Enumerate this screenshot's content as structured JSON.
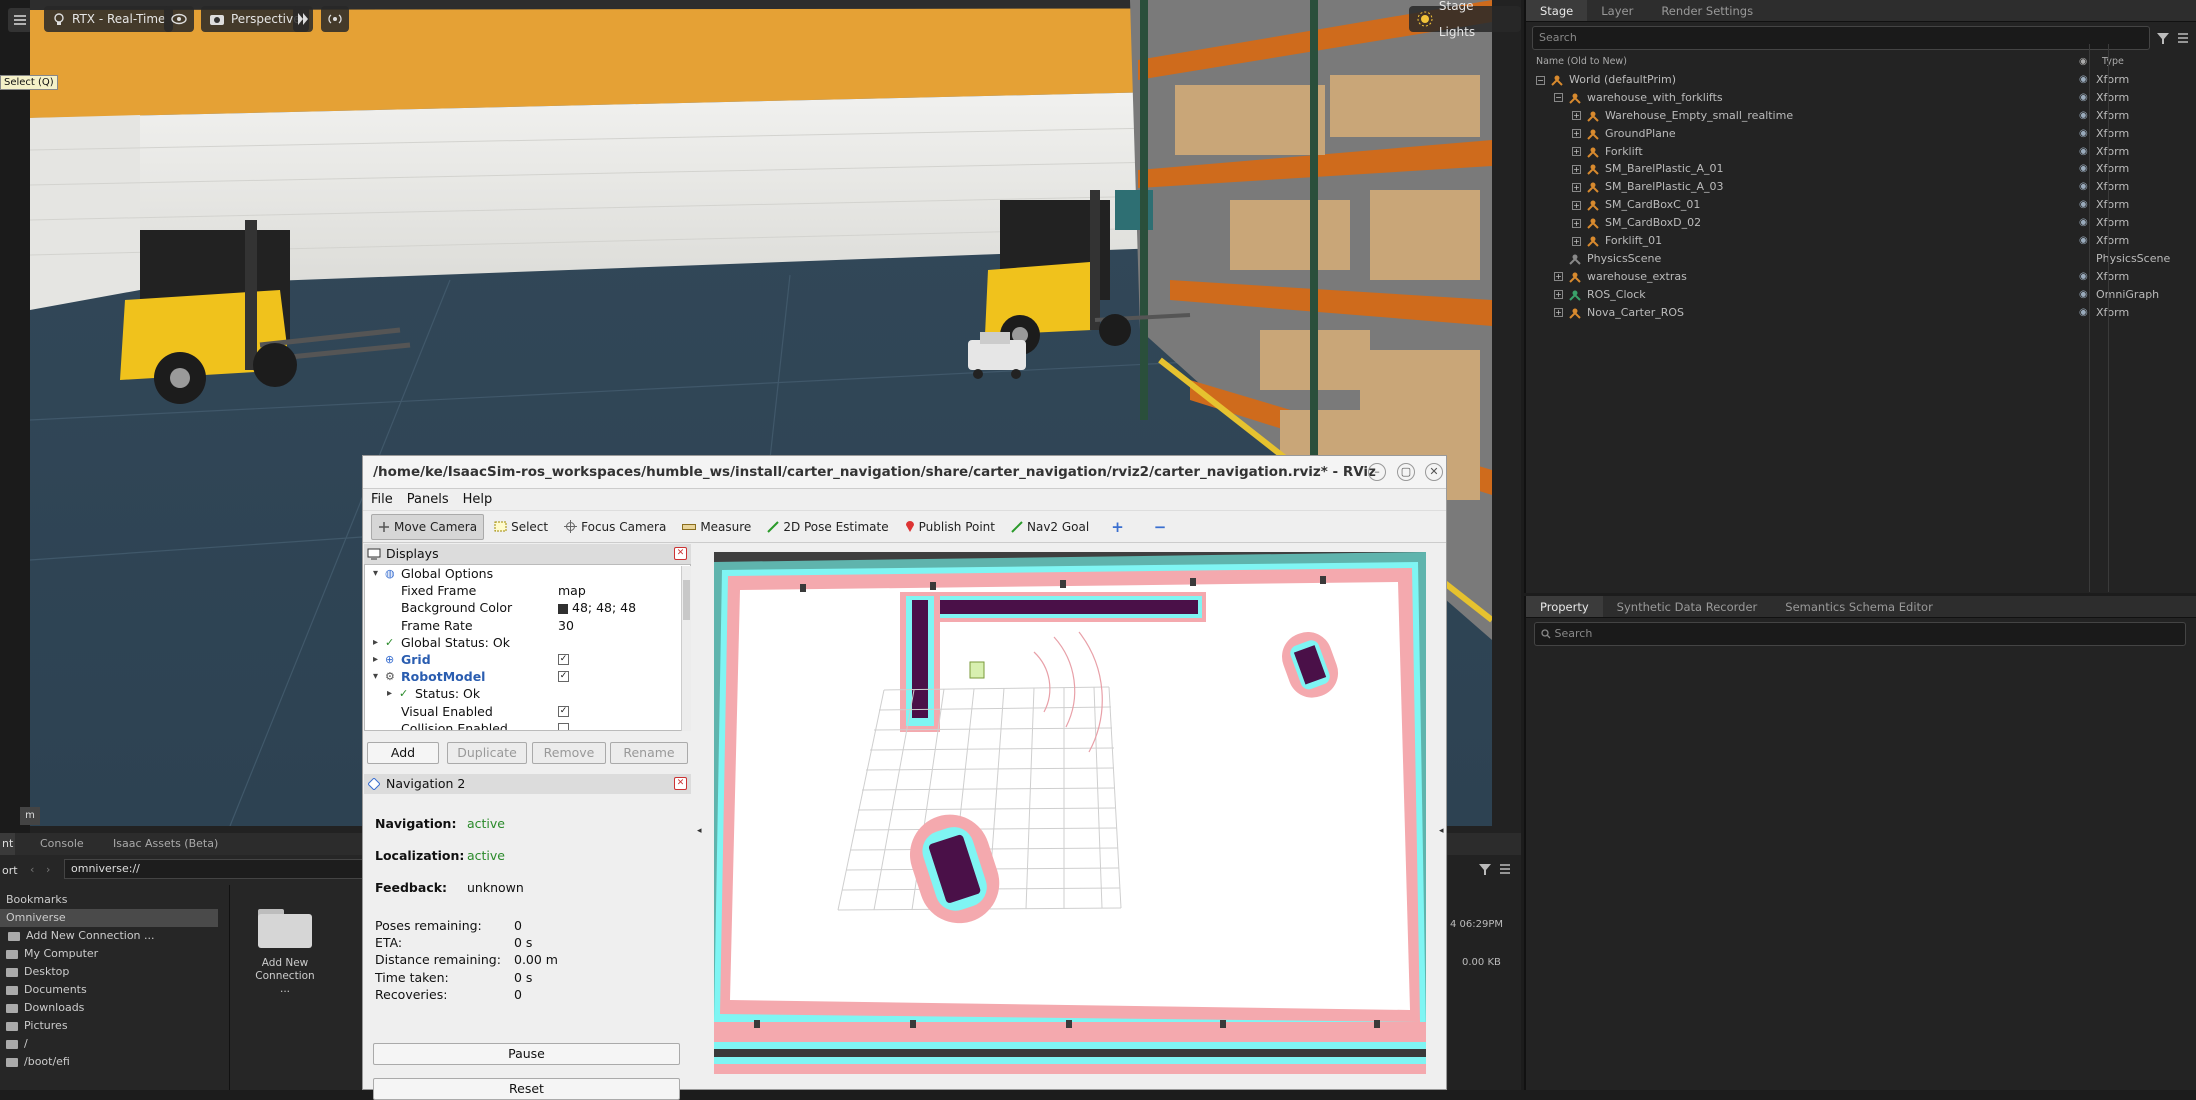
{
  "viewport": {
    "renderer_label": "RTX - Real-Time",
    "camera_label": "Perspective",
    "stage_lights_label": "Stage Lights",
    "select_tooltip": "Select (Q)",
    "m_badge": "m"
  },
  "stage": {
    "tabs": [
      "Stage",
      "Layer",
      "Render Settings"
    ],
    "search_placeholder": "Search",
    "col_name": "Name (Old to New)",
    "col_type": "Type",
    "rows": [
      {
        "name": "World (defaultPrim)",
        "type": "Xform",
        "depth": 0,
        "exp": "−"
      },
      {
        "name": "warehouse_with_forklifts",
        "type": "Xform",
        "depth": 1,
        "exp": "−"
      },
      {
        "name": "Warehouse_Empty_small_realtime",
        "type": "Xform",
        "depth": 2,
        "exp": "+"
      },
      {
        "name": "GroundPlane",
        "type": "Xform",
        "depth": 2,
        "exp": "+"
      },
      {
        "name": "Forklift",
        "type": "Xform",
        "depth": 2,
        "exp": "+"
      },
      {
        "name": "SM_BarelPlastic_A_01",
        "type": "Xform",
        "depth": 2,
        "exp": "+"
      },
      {
        "name": "SM_BarelPlastic_A_03",
        "type": "Xform",
        "depth": 2,
        "exp": "+"
      },
      {
        "name": "SM_CardBoxC_01",
        "type": "Xform",
        "depth": 2,
        "exp": "+"
      },
      {
        "name": "SM_CardBoxD_02",
        "type": "Xform",
        "depth": 2,
        "exp": "+"
      },
      {
        "name": "Forklift_01",
        "type": "Xform",
        "depth": 2,
        "exp": "+"
      },
      {
        "name": "PhysicsScene",
        "type": "PhysicsScene",
        "depth": 1,
        "exp": ""
      },
      {
        "name": "warehouse_extras",
        "type": "Xform",
        "depth": 1,
        "exp": "+"
      },
      {
        "name": "ROS_Clock",
        "type": "OmniGraph",
        "depth": 1,
        "exp": "+"
      },
      {
        "name": "Nova_Carter_ROS",
        "type": "Xform",
        "depth": 1,
        "exp": "+"
      }
    ]
  },
  "property": {
    "tabs": [
      "Property",
      "Synthetic Data Recorder",
      "Semantics Schema Editor"
    ],
    "search_placeholder": "Search"
  },
  "content": {
    "tabs": [
      "Console",
      "Isaac Assets (Beta)"
    ],
    "left_tab_fragment": "nt",
    "path_fragment": "ort",
    "path": "omniverse://",
    "sidebar": [
      "Bookmarks",
      "Omniverse",
      "Add New Connection ...",
      "My Computer",
      "Desktop",
      "Documents",
      "Downloads",
      "Pictures",
      "/",
      "/boot/efi"
    ],
    "folder_label": "Add New Connection ...",
    "date_fragment": "4 06:29PM",
    "size_fragment": "0.00 KB"
  },
  "rviz": {
    "title": "/home/ke/IsaacSim-ros_workspaces/humble_ws/install/carter_navigation/share/carter_navigation/rviz2/carter_navigation.rviz* - RViz",
    "menu": [
      "File",
      "Panels",
      "Help"
    ],
    "tools": [
      "Move Camera",
      "Select",
      "Focus Camera",
      "Measure",
      "2D Pose Estimate",
      "Publish Point",
      "Nav2 Goal"
    ],
    "displays_title": "Displays",
    "props": [
      {
        "label": "Global Options",
        "value": "",
        "indent": 0,
        "arrow": "▾",
        "icon": "globe"
      },
      {
        "label": "Fixed Frame",
        "value": "map",
        "indent": 1,
        "arrow": "",
        "icon": ""
      },
      {
        "label": "Background Color",
        "value": "48; 48; 48",
        "indent": 1,
        "arrow": "",
        "icon": "swatch"
      },
      {
        "label": "Frame Rate",
        "value": "30",
        "indent": 1,
        "arrow": "",
        "icon": ""
      },
      {
        "label": "Global Status: Ok",
        "value": "",
        "indent": 0,
        "arrow": "▸",
        "icon": "check"
      },
      {
        "label": "Grid",
        "value": "✓",
        "indent": 0,
        "arrow": "▸",
        "icon": "grid"
      },
      {
        "label": "RobotModel",
        "value": "✓",
        "indent": 0,
        "arrow": "▾",
        "icon": "robot"
      },
      {
        "label": "Status: Ok",
        "value": "",
        "indent": 1,
        "arrow": "▸",
        "icon": "check"
      },
      {
        "label": "Visual Enabled",
        "value": "✓",
        "indent": 1,
        "arrow": "",
        "icon": ""
      },
      {
        "label": "Collision Enabled",
        "value": " ",
        "indent": 1,
        "arrow": "",
        "icon": ""
      }
    ],
    "buttons": {
      "add": "Add",
      "duplicate": "Duplicate",
      "remove": "Remove",
      "rename": "Rename"
    },
    "nav_title": "Navigation 2",
    "nav_label": "Navigation:",
    "nav_value": "active",
    "loc_label": "Localization:",
    "loc_value": "active",
    "fb_label": "Feedback:",
    "fb_value": "unknown",
    "stats": [
      {
        "label": "Poses remaining:",
        "value": "0"
      },
      {
        "label": "ETA:",
        "value": "0 s"
      },
      {
        "label": "Distance remaining:",
        "value": "0.00 m"
      },
      {
        "label": "Time taken:",
        "value": "0 s"
      },
      {
        "label": "Recoveries:",
        "value": "0"
      }
    ],
    "pause": "Pause",
    "reset": "Reset"
  },
  "colors": {
    "accent_green": "#2a8a2a",
    "link_blue": "#2a5db0"
  }
}
